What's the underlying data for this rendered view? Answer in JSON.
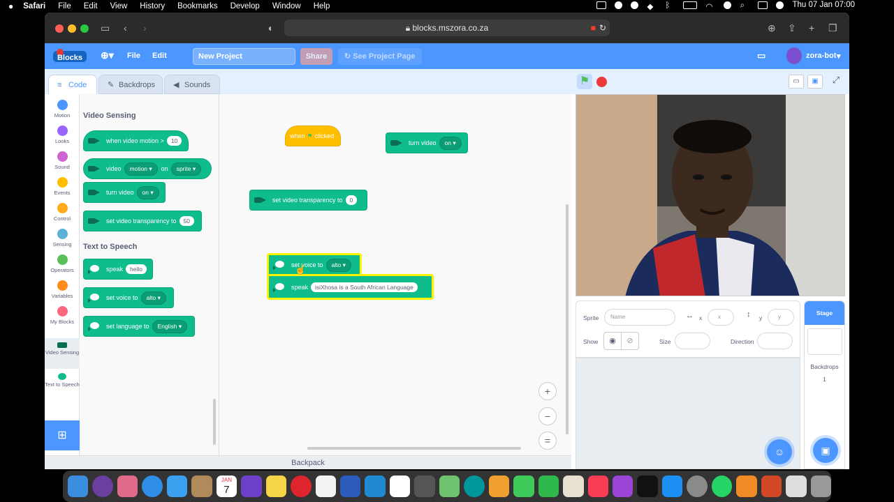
{
  "menubar": {
    "app": "Safari",
    "items": [
      "File",
      "Edit",
      "View",
      "History",
      "Bookmarks",
      "Develop",
      "Window",
      "Help"
    ],
    "clock": "Thu 07 Jan  07:00"
  },
  "safari": {
    "url": "blocks.mszora.co.za"
  },
  "scratch_menu": {
    "file": "File",
    "edit": "Edit",
    "project_title": "New Project",
    "share": "Share",
    "see_project": "See Project Page",
    "user": "zora-bot"
  },
  "tabs": {
    "code": "Code",
    "backdrops": "Backdrops",
    "sounds": "Sounds"
  },
  "categories": [
    {
      "label": "Motion",
      "color": "#4c97ff"
    },
    {
      "label": "Looks",
      "color": "#9966ff"
    },
    {
      "label": "Sound",
      "color": "#cf63cf"
    },
    {
      "label": "Events",
      "color": "#ffbf00"
    },
    {
      "label": "Control",
      "color": "#ffab19"
    },
    {
      "label": "Sensing",
      "color": "#5cb1d6"
    },
    {
      "label": "Operators",
      "color": "#59c059"
    },
    {
      "label": "Variables",
      "color": "#ff8c1a"
    },
    {
      "label": "My Blocks",
      "color": "#ff6680"
    },
    {
      "label": "Video Sensing",
      "color": "#0fbd8c"
    },
    {
      "label": "Text to Speech",
      "color": "#0fbd8c"
    }
  ],
  "palette": {
    "video_title": "Video Sensing",
    "when_motion": "when video motion >",
    "when_motion_val": "10",
    "video": "video",
    "video_dd": "motion",
    "on": "on",
    "sprite_dd": "sprite",
    "turn_video": "turn video",
    "turn_video_dd": "on",
    "set_transparency": "set video transparency to",
    "set_transparency_val": "50",
    "tts_title": "Text to Speech",
    "speak": "speak",
    "speak_val": "hello",
    "set_voice": "set voice to",
    "voice_dd": "alto",
    "set_language": "set language to",
    "language_dd": "English"
  },
  "workspace": {
    "when_flag_a": "when",
    "when_flag_b": "clicked",
    "turn_video": "turn video",
    "turn_video_dd": "on",
    "set_transparency": "set video transparency to",
    "set_transparency_val": "0",
    "set_voice": "set voice to",
    "voice_dd": "alto",
    "speak": "speak",
    "speak_text": "isiXhosa is a South African Language",
    "zoom_in": "+",
    "zoom_out": "−",
    "zoom_reset": "="
  },
  "backpack": "Backpack",
  "sprite_info": {
    "sprite_label": "Sprite",
    "name_placeholder": "Name",
    "x_label": "x",
    "x_placeholder": "x",
    "y_label": "y",
    "y_placeholder": "y",
    "show_label": "Show",
    "size_label": "Size",
    "direction_label": "Direction"
  },
  "stage_panel": {
    "title": "Stage",
    "backdrops_label": "Backdrops",
    "backdrops_count": "1"
  },
  "dock_calendar": {
    "month": "JAN",
    "day": "7"
  }
}
